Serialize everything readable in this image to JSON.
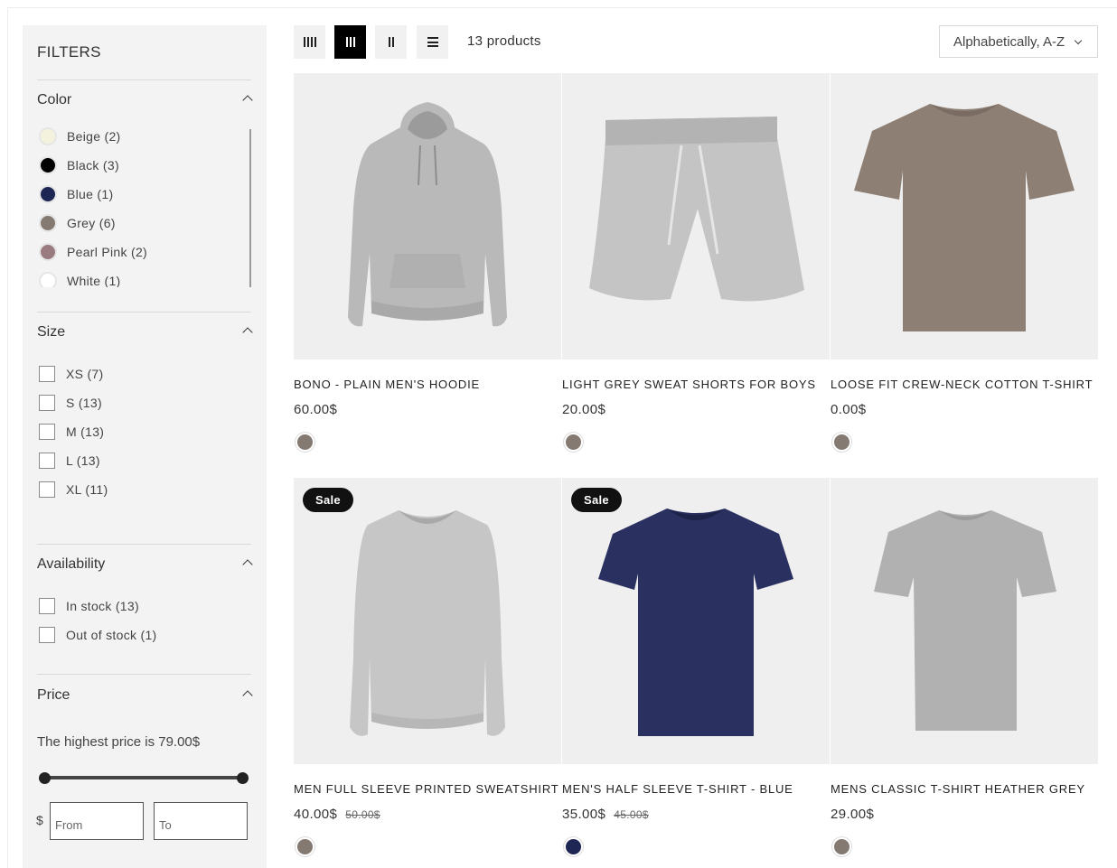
{
  "filters": {
    "title": "FILTERS",
    "color": {
      "title": "Color",
      "options": [
        {
          "label": "Beige (2)",
          "swatch": "#f4f2dc"
        },
        {
          "label": "Black (3)",
          "swatch": "#000000"
        },
        {
          "label": "Blue (1)",
          "swatch": "#1e2653"
        },
        {
          "label": "Grey (6)",
          "swatch": "#857a72"
        },
        {
          "label": "Pearl Pink (2)",
          "swatch": "#9a7b80"
        },
        {
          "label": "White (1)",
          "swatch": "#ffffff"
        }
      ]
    },
    "size": {
      "title": "Size",
      "options": [
        "XS (7)",
        "S (13)",
        "M (13)",
        "L (13)",
        "XL (11)"
      ]
    },
    "availability": {
      "title": "Availability",
      "options": [
        "In stock (13)",
        "Out of stock (1)"
      ]
    },
    "price": {
      "title": "Price",
      "note": "The highest price is 79.00$",
      "currency": "$",
      "from_placeholder": "From",
      "to_placeholder": "To"
    }
  },
  "toolbar": {
    "product_count": "13 products",
    "sort_value": "Alphabetically, A-Z"
  },
  "products": [
    {
      "name": "BONO - PLAIN MEN'S HOODIE",
      "price": "60.00$",
      "compare": "",
      "sale": "",
      "swatch": "#857a72"
    },
    {
      "name": "LIGHT GREY SWEAT SHORTS FOR BOYS",
      "price": "20.00$",
      "compare": "",
      "sale": "",
      "swatch": "#857a72"
    },
    {
      "name": "LOOSE FIT CREW-NECK COTTON T-SHIRT",
      "price": "0.00$",
      "compare": "",
      "sale": "",
      "swatch": "#857a72"
    },
    {
      "name": "MEN FULL SLEEVE PRINTED SWEATSHIRT",
      "price": "40.00$",
      "compare": "50.00$",
      "sale": "Sale",
      "swatch": "#857a72"
    },
    {
      "name": "MEN'S HALF SLEEVE T-SHIRT - BLUE",
      "price": "35.00$",
      "compare": "45.00$",
      "sale": "Sale",
      "swatch": "#1e2653"
    },
    {
      "name": "MENS CLASSIC T-SHIRT HEATHER GREY",
      "price": "29.00$",
      "compare": "",
      "sale": "",
      "swatch": "#857a72"
    }
  ]
}
